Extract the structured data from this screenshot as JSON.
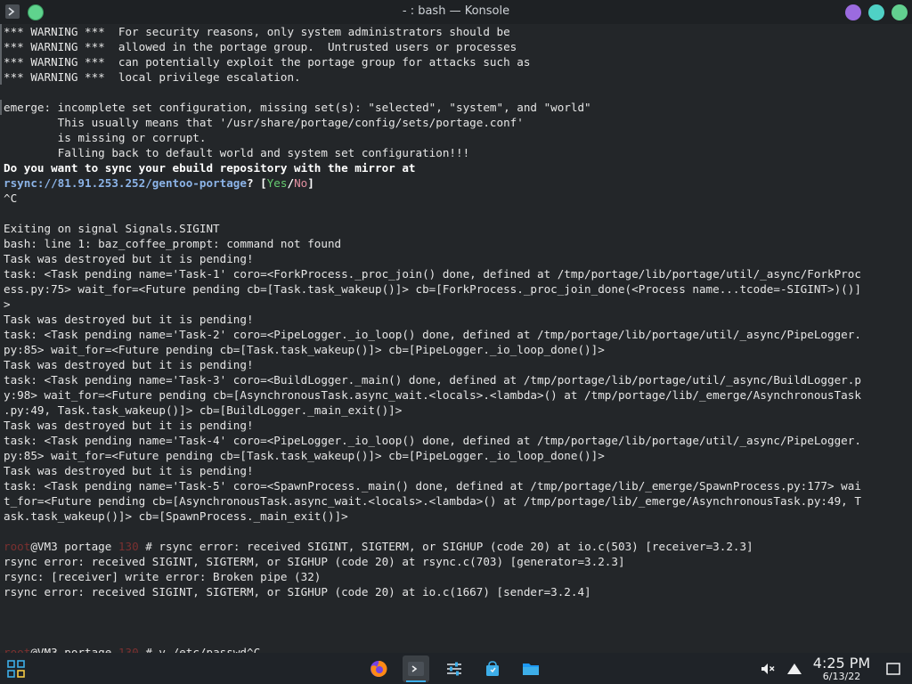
{
  "window": {
    "title": "- : bash — Konsole",
    "colors": {
      "min": "#9b6bdf",
      "max": "#4fd1c5",
      "close": "#62d08f"
    }
  },
  "terminal": {
    "lines": [
      [
        {
          "t": "*** WARNING ***  For security reasons, only system administrators should be"
        }
      ],
      [
        {
          "t": "*** WARNING ***  allowed in the portage group.  Untrusted users or processes"
        }
      ],
      [
        {
          "t": "*** WARNING ***  can potentially exploit the portage group for attacks such as"
        }
      ],
      [
        {
          "t": "*** WARNING ***  local privilege escalation."
        }
      ],
      [
        {
          "t": ""
        }
      ],
      [
        {
          "t": "emerge: incomplete set configuration, missing set(s): \"selected\", \"system\", and \"world\""
        }
      ],
      [
        {
          "t": "        This usually means that '/usr/share/portage/config/sets/portage.conf'"
        }
      ],
      [
        {
          "t": "        is missing or corrupt."
        }
      ],
      [
        {
          "t": "        Falling back to default world and system set configuration!!!"
        }
      ],
      [
        {
          "t": "Do you want to sync your ebuild repository with the mirror at",
          "s": "bold"
        }
      ],
      [
        {
          "t": "rsync://81.91.253.252/gentoo-portage",
          "s": "link"
        },
        {
          "t": "? [",
          "s": "bold"
        },
        {
          "t": "Yes",
          "s": "yes"
        },
        {
          "t": "/",
          "s": "bold"
        },
        {
          "t": "No",
          "s": "no"
        },
        {
          "t": "]",
          "s": "bold"
        }
      ],
      [
        {
          "t": "^C"
        }
      ],
      [
        {
          "t": ""
        }
      ],
      [
        {
          "t": "Exiting on signal Signals.SIGINT"
        }
      ],
      [
        {
          "t": "bash: line 1: baz_coffee_prompt: command not found"
        }
      ],
      [
        {
          "t": "Task was destroyed but it is pending!"
        }
      ],
      [
        {
          "t": "task: <Task pending name='Task-1' coro=<ForkProcess._proc_join() done, defined at /tmp/portage/lib/portage/util/_async/ForkProc"
        }
      ],
      [
        {
          "t": "ess.py:75> wait_for=<Future pending cb=[Task.task_wakeup()]> cb=[ForkProcess._proc_join_done(<Process name...tcode=-SIGINT>)()]"
        }
      ],
      [
        {
          "t": ">"
        }
      ],
      [
        {
          "t": "Task was destroyed but it is pending!"
        }
      ],
      [
        {
          "t": "task: <Task pending name='Task-2' coro=<PipeLogger._io_loop() done, defined at /tmp/portage/lib/portage/util/_async/PipeLogger."
        }
      ],
      [
        {
          "t": "py:85> wait_for=<Future pending cb=[Task.task_wakeup()]> cb=[PipeLogger._io_loop_done()]>"
        }
      ],
      [
        {
          "t": "Task was destroyed but it is pending!"
        }
      ],
      [
        {
          "t": "task: <Task pending name='Task-3' coro=<BuildLogger._main() done, defined at /tmp/portage/lib/portage/util/_async/BuildLogger.p"
        }
      ],
      [
        {
          "t": "y:98> wait_for=<Future pending cb=[AsynchronousTask.async_wait.<locals>.<lambda>() at /tmp/portage/lib/_emerge/AsynchronousTask"
        }
      ],
      [
        {
          "t": ".py:49, Task.task_wakeup()]> cb=[BuildLogger._main_exit()]>"
        }
      ],
      [
        {
          "t": "Task was destroyed but it is pending!"
        }
      ],
      [
        {
          "t": "task: <Task pending name='Task-4' coro=<PipeLogger._io_loop() done, defined at /tmp/portage/lib/portage/util/_async/PipeLogger."
        }
      ],
      [
        {
          "t": "py:85> wait_for=<Future pending cb=[Task.task_wakeup()]> cb=[PipeLogger._io_loop_done()]>"
        }
      ],
      [
        {
          "t": "Task was destroyed but it is pending!"
        }
      ],
      [
        {
          "t": "task: <Task pending name='Task-5' coro=<SpawnProcess._main() done, defined at /tmp/portage/lib/_emerge/SpawnProcess.py:177> wai"
        }
      ],
      [
        {
          "t": "t_for=<Future pending cb=[AsynchronousTask.async_wait.<locals>.<lambda>() at /tmp/portage/lib/_emerge/AsynchronousTask.py:49, T"
        }
      ],
      [
        {
          "t": "ask.task_wakeup()]> cb=[SpawnProcess._main_exit()]>"
        }
      ],
      [
        {
          "t": ""
        }
      ],
      [
        {
          "t": "root",
          "s": "root"
        },
        {
          "t": "@VM3 portage ",
          "s": "cwd"
        },
        {
          "t": "130",
          "s": "code"
        },
        {
          "t": " # rsync error: received SIGINT, SIGTERM, or SIGHUP (code 20) at io.c(503) [receiver=3.2.3]"
        }
      ],
      [
        {
          "t": "rsync error: received SIGINT, SIGTERM, or SIGHUP (code 20) at rsync.c(703) [generator=3.2.3]"
        }
      ],
      [
        {
          "t": "rsync: [receiver] write error: Broken pipe (32)"
        }
      ],
      [
        {
          "t": "rsync error: received SIGINT, SIGTERM, or SIGHUP (code 20) at io.c(1667) [sender=3.2.4]"
        }
      ],
      [
        {
          "t": ""
        }
      ],
      [
        {
          "t": ""
        }
      ],
      [
        {
          "t": ""
        }
      ],
      [
        {
          "t": "root",
          "s": "root"
        },
        {
          "t": "@VM3 portage ",
          "s": "cwd"
        },
        {
          "t": "130",
          "s": "code"
        },
        {
          "t": " # v /etc/passwd^C"
        }
      ]
    ]
  },
  "taskbar": {
    "clock": {
      "time": "4:25 PM",
      "date": "6/13/22"
    },
    "icons": {
      "launcher": "application-launcher-icon",
      "firefox": "firefox-icon",
      "konsole": "konsole-terminal-icon",
      "settings": "system-settings-icon",
      "store": "discover-store-icon",
      "files": "dolphin-folder-icon",
      "volume": "speaker-muted-icon",
      "network": "network-icon",
      "desktop": "show-desktop-icon"
    },
    "accent": "#3daee9"
  }
}
